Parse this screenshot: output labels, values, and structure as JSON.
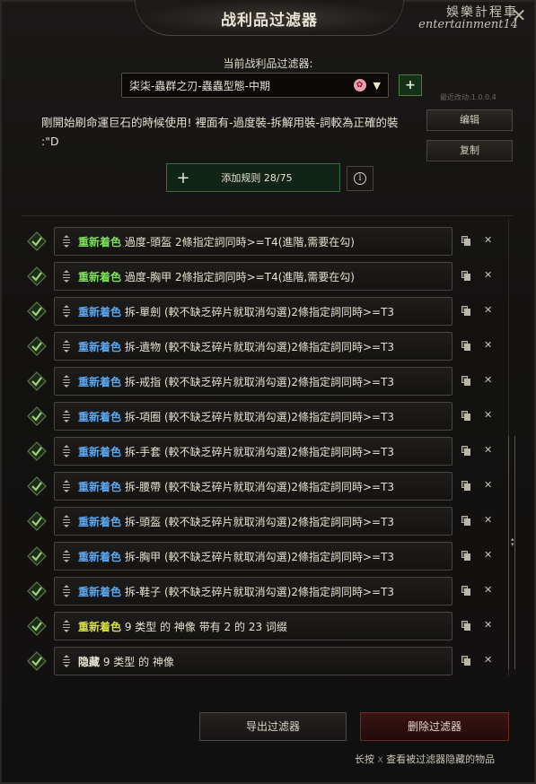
{
  "window": {
    "title": "战利品过滤器",
    "watermark_top": "娛樂計程車",
    "watermark_bottom": "entertainment14",
    "close_label": "✕"
  },
  "filter_select": {
    "label": "当前战利品过滤器:",
    "value": "柒柒-蟲群之刃-蟲蟲型態-中期",
    "badge": "✿",
    "arrow": "▼",
    "add_label": "+"
  },
  "version_text": "最近改动:1.0.0.4",
  "description": "剛開始刷命運巨石的時候使用! 裡面有-過度裝-拆解用裝-詞較為正確的裝 :\"D",
  "side_buttons": {
    "edit": "编辑",
    "copy": "复制"
  },
  "add_rule": {
    "plus": "+",
    "label": "添加规则 28/75",
    "info": "i"
  },
  "rules": [
    {
      "action": "重新着色",
      "color": "green",
      "text": "過度-頭盔 2條指定詞同時>=T4(進階,需要在勾)"
    },
    {
      "action": "重新着色",
      "color": "green",
      "text": "過度-胸甲 2條指定詞同時>=T4(進階,需要在勾)"
    },
    {
      "action": "重新着色",
      "color": "blue",
      "text": "拆-單劍 (較不缺乏碎片就取消勾選)2條指定詞同時>=T3"
    },
    {
      "action": "重新着色",
      "color": "blue",
      "text": "拆-遺物 (較不缺乏碎片就取消勾選)2條指定詞同時>=T3"
    },
    {
      "action": "重新着色",
      "color": "blue",
      "text": "拆-戒指 (較不缺乏碎片就取消勾選)2條指定詞同時>=T3"
    },
    {
      "action": "重新着色",
      "color": "blue",
      "text": "拆-項圈 (較不缺乏碎片就取消勾選)2條指定詞同時>=T3"
    },
    {
      "action": "重新着色",
      "color": "blue",
      "text": "拆-手套 (較不缺乏碎片就取消勾選)2條指定詞同時>=T3"
    },
    {
      "action": "重新着色",
      "color": "blue",
      "text": "拆-腰帶 (較不缺乏碎片就取消勾選)2條指定詞同時>=T3"
    },
    {
      "action": "重新着色",
      "color": "blue",
      "text": "拆-頭盔 (較不缺乏碎片就取消勾選)2條指定詞同時>=T3"
    },
    {
      "action": "重新着色",
      "color": "blue",
      "text": "拆-胸甲 (較不缺乏碎片就取消勾選)2條指定詞同時>=T3"
    },
    {
      "action": "重新着色",
      "color": "blue",
      "text": "拆-鞋子 (較不缺乏碎片就取消勾選)2條指定詞同時>=T3"
    },
    {
      "action": "重新着色",
      "color": "yellow",
      "text": "9 类型 的 神像 带有 2 的 23 词缀"
    },
    {
      "action": "隐藏",
      "color": "white",
      "text": "9 类型 的 神像"
    }
  ],
  "colors": {
    "green": "#7de05a",
    "blue": "#5aa8f0",
    "yellow": "#d8e040",
    "check": "#9fd47a"
  },
  "bottom": {
    "export": "导出过滤器",
    "delete": "删除过滤器",
    "hint_prefix": "长按",
    "hint_key": "X",
    "hint_suffix": "查看被过滤器隐藏的物品"
  }
}
